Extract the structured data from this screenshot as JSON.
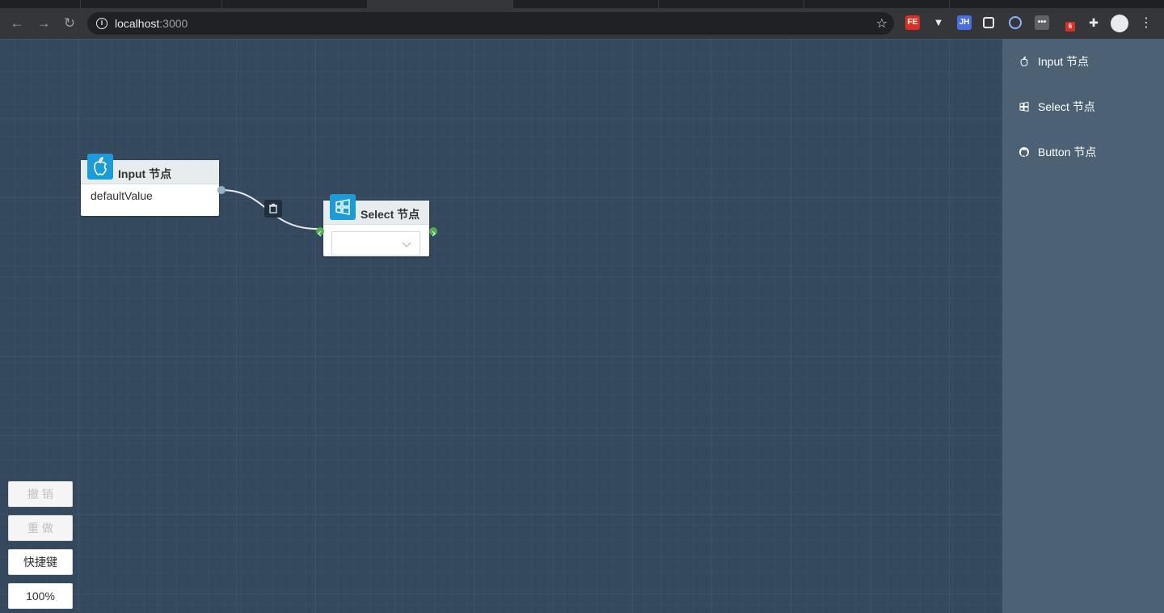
{
  "browser": {
    "url_host": "localhost",
    "url_port": ":3000",
    "extensions": [
      {
        "name": "fe-extension-icon",
        "label": "FE",
        "color": "#d93025"
      },
      {
        "name": "vue-devtools-icon",
        "label": "▼",
        "color": "transparent"
      },
      {
        "name": "jh-extension-icon",
        "label": "JH",
        "color": "#4a6ee0"
      },
      {
        "name": "square-extension-icon",
        "label": "",
        "color": "transparent"
      },
      {
        "name": "github-extension-icon",
        "label": "",
        "color": "transparent"
      },
      {
        "name": "more-extension-icon",
        "label": "•••",
        "color": "#5f6368"
      },
      {
        "name": "badge-extension-icon",
        "label": "6",
        "color": "#d93025"
      },
      {
        "name": "puzzle-extension-icon",
        "label": "",
        "color": "transparent"
      }
    ]
  },
  "nodes": {
    "input": {
      "title": "Input 节点",
      "value": "defaultValue"
    },
    "select": {
      "title": "Select 节点",
      "value": ""
    }
  },
  "sidebar": {
    "items": [
      {
        "label": "Input 节点",
        "icon": "apple-icon"
      },
      {
        "label": "Select 节点",
        "icon": "windows-icon"
      },
      {
        "label": "Button 节点",
        "icon": "github-icon"
      }
    ]
  },
  "controls": {
    "undo_label": "撤 销",
    "redo_label": "重 做",
    "shortcuts_label": "快捷键",
    "zoom_label": "100%"
  },
  "colors": {
    "canvas_bg": "#35495e",
    "sidebar_bg": "#4c6173",
    "node_icon_bg": "#1b9bd8",
    "port_green": "#4caf50"
  }
}
